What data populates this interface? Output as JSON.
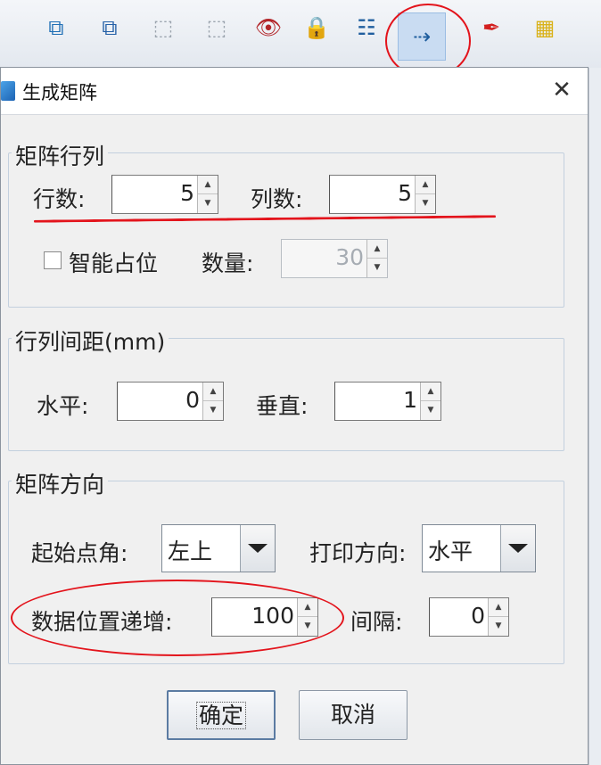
{
  "toolbar": {
    "buttons": [
      {
        "name": "group-icon",
        "glyph": "⧉",
        "color": "#1f6fb5"
      },
      {
        "name": "ungroup-icon",
        "glyph": "⧉",
        "color": "#2460a7"
      },
      {
        "name": "align-frame-icon",
        "glyph": "⬚",
        "color": "#9aa3ad"
      },
      {
        "name": "align-frame-2-icon",
        "glyph": "⬚",
        "color": "#9aa3ad"
      },
      {
        "name": "eye-icon",
        "glyph": "👁",
        "color": "#b3262a"
      },
      {
        "name": "lock-icon",
        "glyph": "🔒",
        "color": "#2c7fd0"
      },
      {
        "name": "checklist-icon",
        "glyph": "☷",
        "color": "#1f5e9e"
      },
      {
        "name": "matrix-icon",
        "glyph": "⇢",
        "color": "#1f5e9e"
      },
      {
        "name": "pdf-icon",
        "glyph": "✒",
        "color": "#d31f1f"
      },
      {
        "name": "calculator-icon",
        "glyph": "▦",
        "color": "#d9b21a"
      }
    ]
  },
  "dialog": {
    "title": "生成矩阵",
    "close_glyph": "✕",
    "matrix_group": {
      "legend": "矩阵行列",
      "rows_label": "行数:",
      "rows_value": "5",
      "cols_label": "列数:",
      "cols_value": "5",
      "smart_label": "智能占位",
      "quantity_label": "数量:",
      "quantity_value": "30"
    },
    "spacing_group": {
      "legend": "行列间距(mm)",
      "horizontal_label": "水平:",
      "horizontal_value": "0",
      "vertical_label": "垂直:",
      "vertical_value": "1"
    },
    "direction_group": {
      "legend": "矩阵方向",
      "start_label": "起始点角:",
      "start_value": "左上",
      "print_dir_label": "打印方向:",
      "print_dir_value": "水平",
      "increment_label": "数据位置递增:",
      "increment_value": "100",
      "interval_label": "间隔:",
      "interval_value": "0"
    },
    "ok_label": "确定",
    "cancel_label": "取消"
  },
  "colors": {
    "annotation_red": "#e3141c",
    "toolbar_active": "#c9dcf2"
  }
}
